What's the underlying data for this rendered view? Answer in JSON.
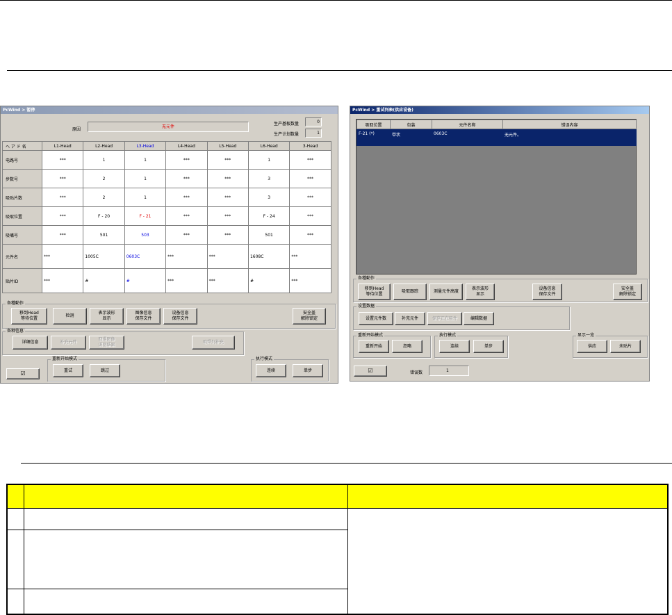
{
  "left": {
    "title": "PcWind > 暂停",
    "reason_label": "原因",
    "reason_value": "无元件",
    "prod_count_label": "生产基板数量",
    "prod_count_value": "0",
    "plan_count_label": "生产计划数量",
    "plan_count_value": "1",
    "corner_label": "ヘ ア ド 名",
    "heads": [
      "L1-Head",
      "L2-Head",
      "L3-Head",
      "L4-Head",
      "L5-Head",
      "L6-Head",
      "3-Head"
    ],
    "rows": [
      {
        "label": "电路号",
        "cells": [
          "***",
          "1",
          "1",
          "***",
          "***",
          "1",
          "***"
        ]
      },
      {
        "label": "步数号",
        "cells": [
          "***",
          "2",
          "1",
          "***",
          "***",
          "3",
          "***"
        ]
      },
      {
        "label": "吸贴片数",
        "cells": [
          "***",
          "2",
          "1",
          "***",
          "***",
          "3",
          "***"
        ]
      },
      {
        "label": "吸取位置",
        "cells": [
          "***",
          "F - 20",
          "F - 21",
          "***",
          "***",
          "F - 24",
          "***"
        ]
      },
      {
        "label": "吸嘴号",
        "cells": [
          "***",
          "501",
          "503",
          "***",
          "***",
          "501",
          "***"
        ]
      },
      {
        "label": "元件名",
        "cells": [
          "***",
          "1005C",
          "0603C",
          "***",
          "***",
          "1608C",
          "***"
        ]
      },
      {
        "label": "贴片ID",
        "cells": [
          "***",
          "#",
          "#",
          "***",
          "***",
          "#",
          "***"
        ]
      }
    ],
    "actions_label": "各種動作",
    "actions": [
      "移到Head\n等待位置",
      "检测",
      "表示波形\n显示",
      "图像信息\n保存文件",
      "设备信息\n保存文件",
      "安全盖\n解除锁定"
    ],
    "info_label": "各种信息",
    "info_buttons": [
      "详细信息",
      "补充元件",
      "取得图像\n识别结果",
      "助焊剂补充"
    ],
    "restart_label": "重新开始模式",
    "restart_buttons": [
      "重试",
      "跳过"
    ],
    "exec_label": "执行模式",
    "exec_buttons": [
      "连续",
      "单步"
    ],
    "checkbox_mark": "☑"
  },
  "right": {
    "title": "PcWind > 重试列表(供应设备)",
    "columns": [
      "吸取位置",
      "包装",
      "元件名称",
      "错误内容"
    ],
    "rows": [
      {
        "pos": "F-21 (*)",
        "pack": "带状",
        "name": "0603C",
        "error": "无元件。"
      }
    ],
    "actions_label": "各種動作",
    "actions": [
      "移到Head\n等待位置",
      "吸取跟踪",
      "测量元件高度",
      "表示波形\n显示",
      "设备信息\n保存文件",
      "安全盖\n解除锁定"
    ],
    "settings_label": "设置数据",
    "settings_buttons": [
      "设置元件数",
      "补充元件",
      "保存正在吸件",
      "编辑数据"
    ],
    "restart_label": "重新开始模式",
    "restart_buttons": [
      "重新开始",
      "忽略"
    ],
    "exec_label": "执行模式",
    "exec_buttons": [
      "连续",
      "单步"
    ],
    "display_label": "显示一览",
    "display_buttons": [
      "供应",
      "未贴片"
    ],
    "error_count_label": "错误数",
    "error_count_value": "1",
    "checkbox_mark": "☑"
  },
  "colors": {
    "window_bg": "#d4d0c8",
    "selected_row": "#0a246a",
    "list_bg": "#808080",
    "header_yellow": "#ffff00",
    "warn_red": "#e00000"
  }
}
